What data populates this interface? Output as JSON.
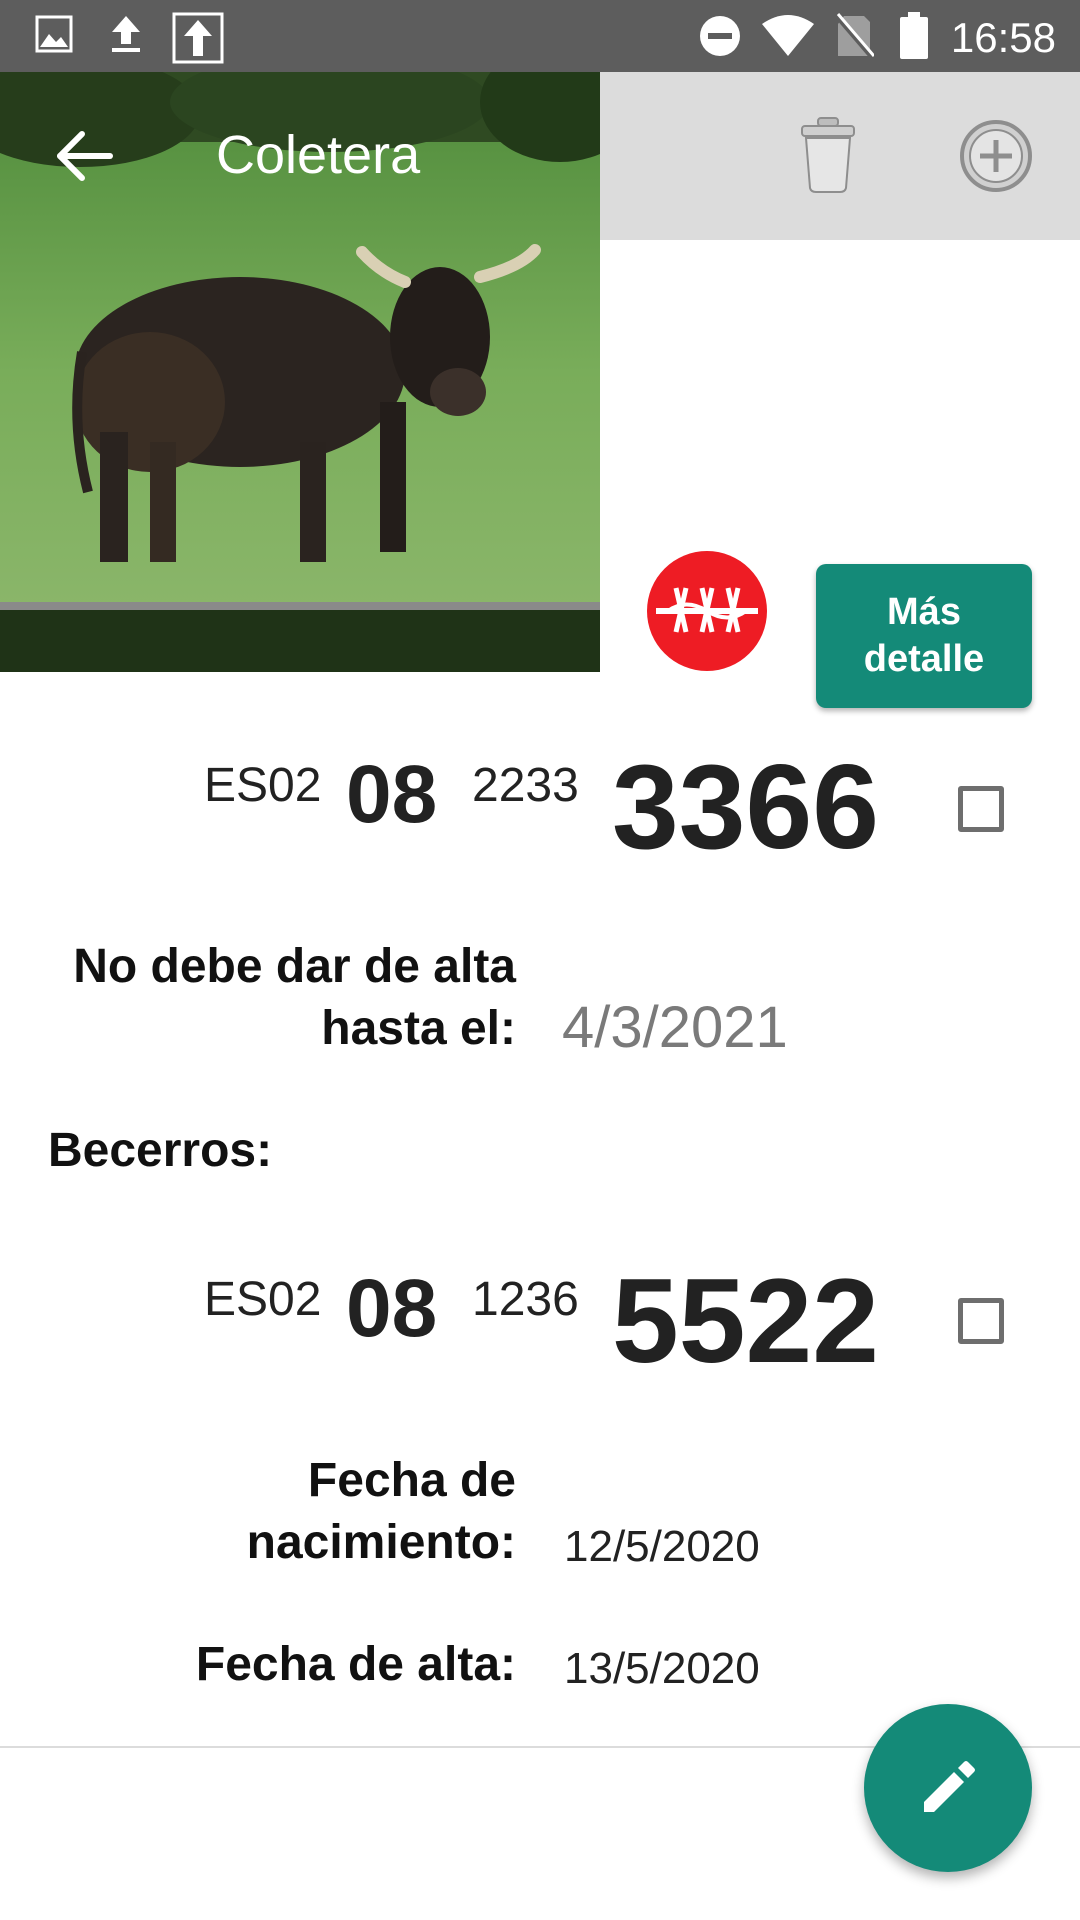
{
  "status_bar": {
    "time": "16:58",
    "left_icons": [
      "image-icon",
      "upload-icon",
      "upload-boxed-icon"
    ],
    "right_icons": [
      "do-not-disturb-icon",
      "wifi-icon",
      "no-sim-icon",
      "battery-icon"
    ]
  },
  "header": {
    "title": "Coletera",
    "back_icon": "arrow-left-icon",
    "actions": [
      "trash-icon",
      "add-circle-icon"
    ]
  },
  "details_button_label": "Más\ndetalle",
  "badge_icon": "no-entry-fence-icon",
  "animal_tag": {
    "country": "ES02",
    "province": "08",
    "middle": "2233",
    "number": "3366",
    "checked": false
  },
  "no_discharge": {
    "label": "No debe dar de alta\nhasta el:",
    "date": "4/3/2021"
  },
  "calves_label": "Becerros:",
  "calf": {
    "tag": {
      "country": "ES02",
      "province": "08",
      "middle": "1236",
      "number": "5522",
      "checked": false
    },
    "birth_label": "Fecha de\nnacimiento:",
    "birth_date": "12/5/2020",
    "entry_label": "Fecha de alta:",
    "entry_date": "13/5/2020"
  },
  "fab_icon": "pencil-icon",
  "colors": {
    "accent": "#148a78",
    "badge_red": "#ee1c24",
    "status_bar": "#5d5d5d"
  }
}
